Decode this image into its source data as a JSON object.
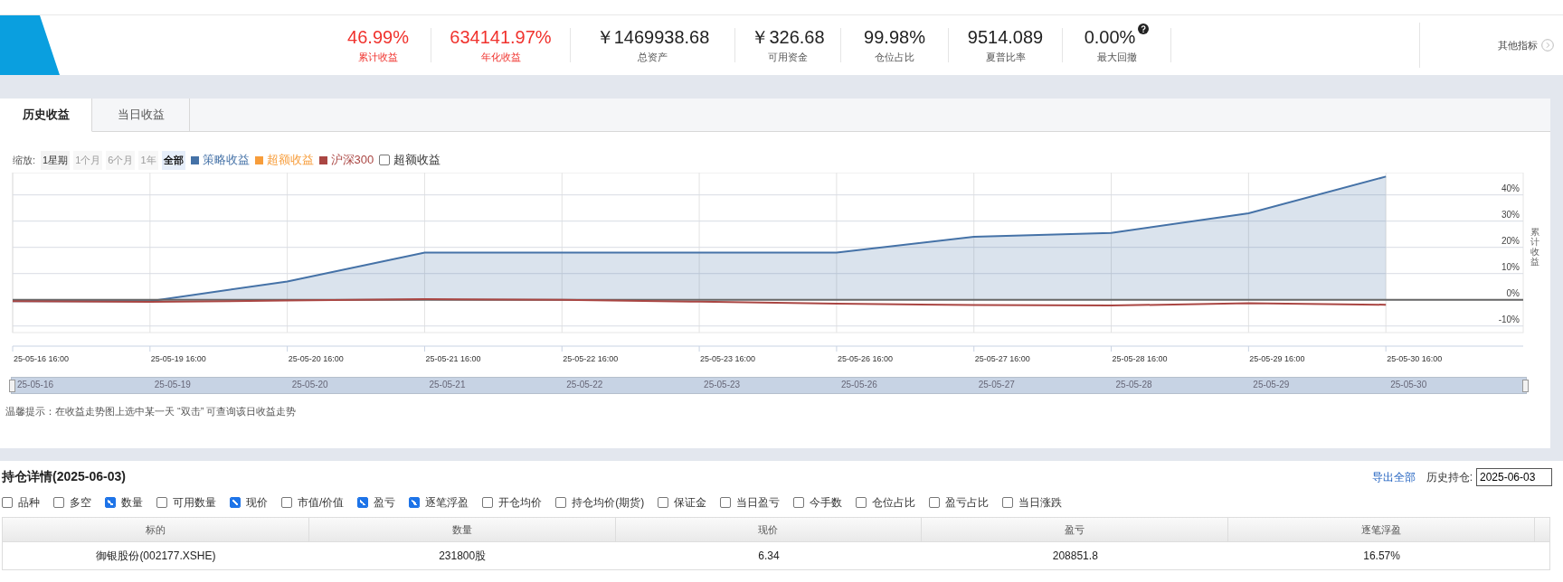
{
  "stats": [
    {
      "value": "46.99%",
      "label": "累计收益",
      "highlighted": true
    },
    {
      "value": "634141.97%",
      "label": "年化收益",
      "highlighted": true
    },
    {
      "value": "￥1469938.68",
      "label": "总资产",
      "highlighted": false
    },
    {
      "value": "￥326.68",
      "label": "可用资金",
      "highlighted": false
    },
    {
      "value": "99.98%",
      "label": "仓位占比",
      "highlighted": false
    },
    {
      "value": "9514.089",
      "label": "夏普比率",
      "highlighted": false
    },
    {
      "value": "0.00%",
      "label": "最大回撤",
      "highlighted": false,
      "help": true
    }
  ],
  "more_metrics": "其他指标",
  "tabs": [
    {
      "label": "历史收益",
      "selected": true
    },
    {
      "label": "当日收益",
      "selected": false
    }
  ],
  "zoom": {
    "label": "缩放:",
    "options": [
      {
        "label": "1星期",
        "selected": false,
        "disabled": false
      },
      {
        "label": "1个月",
        "selected": false,
        "disabled": true
      },
      {
        "label": "6个月",
        "selected": false,
        "disabled": true
      },
      {
        "label": "1年",
        "selected": false,
        "disabled": true
      },
      {
        "label": "全部",
        "selected": true,
        "disabled": false
      }
    ]
  },
  "legend": [
    {
      "kind": "series"
    },
    {
      "kind": "extra",
      "label": "超额收益",
      "color": "#f79d3b"
    },
    {
      "kind": "series"
    }
  ],
  "excess_toggle": {
    "label": "超额收益",
    "checked": false
  },
  "chart_data": {
    "type": "area",
    "grid": true,
    "ylabel": "累计收益",
    "categories": [
      "25-05-16 16:00",
      "25-05-19 16:00",
      "25-05-20 16:00",
      "25-05-21 16:00",
      "25-05-22 16:00",
      "25-05-23 16:00",
      "25-05-26 16:00",
      "25-05-27 16:00",
      "25-05-28 16:00",
      "25-05-29 16:00",
      "25-05-30 16:00"
    ],
    "series": [
      {
        "name": "策略收益",
        "color": "#4572a7",
        "values": [
          -0.5,
          -0.5,
          7,
          18,
          18,
          18,
          18,
          24,
          25.5,
          33,
          47
        ]
      },
      {
        "name": "沪深300",
        "color": "#aa4643",
        "type": "line",
        "values": [
          -0.5,
          -0.8,
          -0.3,
          0.2,
          0,
          -0.7,
          -1.5,
          -2,
          -2.2,
          -1.3,
          -1.9
        ]
      }
    ],
    "ylim": [
      -12.5,
      48.5
    ],
    "yticks": [
      {
        "value": -10,
        "label": "-10%"
      },
      {
        "value": 0,
        "label": "0%"
      },
      {
        "value": 10,
        "label": "10%"
      },
      {
        "value": 20,
        "label": "20%"
      },
      {
        "value": 30,
        "label": "30%"
      },
      {
        "value": 40,
        "label": "40%"
      }
    ]
  },
  "navigator": [
    "25-05-16",
    "25-05-19",
    "25-05-20",
    "25-05-21",
    "25-05-22",
    "25-05-23",
    "25-05-26",
    "25-05-27",
    "25-05-28",
    "25-05-29",
    "25-05-30"
  ],
  "hint": "温馨提示：在收益走势图上选中某一天 “双击” 可查询该日收益走势",
  "positions": {
    "title": "持仓详情(2025-06-03)",
    "export": "导出全部",
    "history_label": "历史持仓:",
    "history_date": "2025-06-03",
    "columns_toggle": [
      {
        "label": "品种",
        "checked": false
      },
      {
        "label": "多空",
        "checked": false
      },
      {
        "label": "数量",
        "checked": true
      },
      {
        "label": "可用数量",
        "checked": false
      },
      {
        "label": "现价",
        "checked": true
      },
      {
        "label": "市值/价值",
        "checked": false
      },
      {
        "label": "盈亏",
        "checked": true
      },
      {
        "label": "逐笔浮盈",
        "checked": true
      },
      {
        "label": "开仓均价",
        "checked": false
      },
      {
        "label": "持仓均价(期货)",
        "checked": false
      },
      {
        "label": "保证金",
        "checked": false
      },
      {
        "label": "当日盈亏",
        "checked": false
      },
      {
        "label": "今手数",
        "checked": false
      },
      {
        "label": "仓位占比",
        "checked": false
      },
      {
        "label": "盈亏占比",
        "checked": false
      },
      {
        "label": "当日涨跌",
        "checked": false
      }
    ],
    "columns": [
      "标的",
      "数量",
      "现价",
      "盈亏",
      "逐笔浮盈"
    ],
    "rows": [
      [
        "御银股份(002177.XSHE)",
        "231800股",
        "6.34",
        "208851.8",
        "16.57%"
      ]
    ]
  }
}
